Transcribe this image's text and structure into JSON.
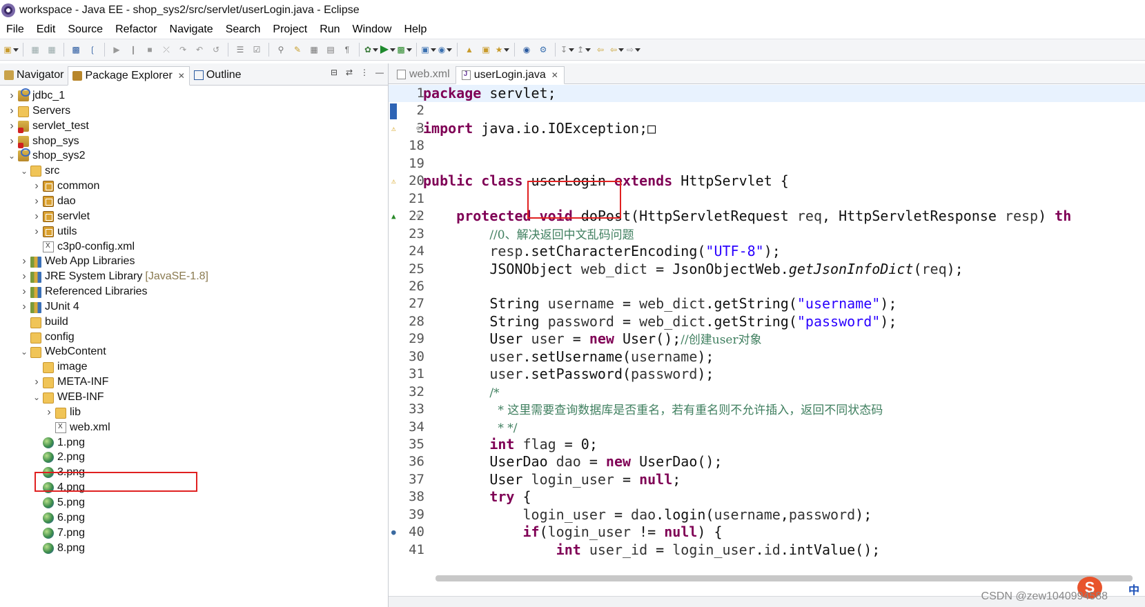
{
  "window": {
    "title": "workspace - Java EE - shop_sys2/src/servlet/userLogin.java - Eclipse"
  },
  "menubar": [
    "File",
    "Edit",
    "Source",
    "Refactor",
    "Navigate",
    "Search",
    "Project",
    "Run",
    "Window",
    "Help"
  ],
  "left_panel": {
    "tabs": [
      {
        "label": "Navigator",
        "icon": "navigator-icon"
      },
      {
        "label": "Package Explorer",
        "icon": "package-explorer-icon",
        "active": true
      },
      {
        "label": "Outline",
        "icon": "outline-icon"
      }
    ],
    "tree": [
      {
        "label": "jdbc_1",
        "icon": "project",
        "indent": 0,
        "chev": "right"
      },
      {
        "label": "Servers",
        "icon": "folder",
        "indent": 0,
        "chev": "right"
      },
      {
        "label": "servlet_test",
        "icon": "project-err",
        "indent": 0,
        "chev": "right"
      },
      {
        "label": "shop_sys",
        "icon": "project-err",
        "indent": 0,
        "chev": "right"
      },
      {
        "label": "shop_sys2",
        "icon": "project",
        "indent": 0,
        "chev": "down"
      },
      {
        "label": "src",
        "icon": "srcfolder",
        "indent": 1,
        "chev": "down"
      },
      {
        "label": "common",
        "icon": "pkg",
        "indent": 2,
        "chev": "right"
      },
      {
        "label": "dao",
        "icon": "pkg",
        "indent": 2,
        "chev": "right"
      },
      {
        "label": "servlet",
        "icon": "pkg",
        "indent": 2,
        "chev": "right"
      },
      {
        "label": "utils",
        "icon": "pkg",
        "indent": 2,
        "chev": "right"
      },
      {
        "label": "c3p0-config.xml",
        "icon": "xml",
        "indent": 2,
        "chev": ""
      },
      {
        "label": "Web App Libraries",
        "icon": "lib",
        "indent": 1,
        "chev": "right"
      },
      {
        "label": "JRE System Library",
        "icon": "lib",
        "indent": 1,
        "chev": "right",
        "decoration": "[JavaSE-1.8]"
      },
      {
        "label": "Referenced Libraries",
        "icon": "lib",
        "indent": 1,
        "chev": "right"
      },
      {
        "label": "JUnit 4",
        "icon": "lib",
        "indent": 1,
        "chev": "right"
      },
      {
        "label": "build",
        "icon": "folder",
        "indent": 1,
        "chev": ""
      },
      {
        "label": "config",
        "icon": "folder",
        "indent": 1,
        "chev": ""
      },
      {
        "label": "WebContent",
        "icon": "folder",
        "indent": 1,
        "chev": "down"
      },
      {
        "label": "image",
        "icon": "folder",
        "indent": 2,
        "chev": ""
      },
      {
        "label": "META-INF",
        "icon": "folder",
        "indent": 2,
        "chev": "right"
      },
      {
        "label": "WEB-INF",
        "icon": "folder",
        "indent": 2,
        "chev": "down"
      },
      {
        "label": "lib",
        "icon": "folder",
        "indent": 3,
        "chev": "right"
      },
      {
        "label": "web.xml",
        "icon": "xml",
        "indent": 3,
        "chev": ""
      },
      {
        "label": "1.png",
        "icon": "png",
        "indent": 2,
        "chev": ""
      },
      {
        "label": "2.png",
        "icon": "png",
        "indent": 2,
        "chev": ""
      },
      {
        "label": "3.png",
        "icon": "png",
        "indent": 2,
        "chev": ""
      },
      {
        "label": "4.png",
        "icon": "png",
        "indent": 2,
        "chev": ""
      },
      {
        "label": "5.png",
        "icon": "png",
        "indent": 2,
        "chev": ""
      },
      {
        "label": "6.png",
        "icon": "png",
        "indent": 2,
        "chev": ""
      },
      {
        "label": "7.png",
        "icon": "png",
        "indent": 2,
        "chev": ""
      },
      {
        "label": "8.png",
        "icon": "png",
        "indent": 2,
        "chev": ""
      }
    ]
  },
  "editor": {
    "tabs": [
      {
        "label": "web.xml",
        "active": false
      },
      {
        "label": "userLogin.java",
        "active": true
      }
    ],
    "lines": [
      {
        "n": "1",
        "html": "<span class=\"kw\">package</span> servlet;",
        "current": true
      },
      {
        "n": "2",
        "html": ""
      },
      {
        "n": "3",
        "html": "<span class=\"kw\">import</span> java.io.IOException;&#9633;",
        "marker": "warn",
        "fold": "+"
      },
      {
        "n": "18",
        "html": ""
      },
      {
        "n": "19",
        "html": ""
      },
      {
        "n": "20",
        "html": "<span class=\"kw\">public</span> <span class=\"kw\">class</span> userLogin <span class=\"kw\">extends</span> HttpServlet {",
        "marker": "warn"
      },
      {
        "n": "21",
        "html": ""
      },
      {
        "n": "22",
        "html": "    <span class=\"kw\">protected</span> <span class=\"kw\">void</span> doPost(HttpServletRequest <span class=\"fld\">req</span>, HttpServletResponse <span class=\"fld\">resp</span>) <span class=\"kw\">th</span>",
        "marker": "arrow",
        "fold": "-"
      },
      {
        "n": "23",
        "html": "        <span class=\"cm\">//0、解决返回中文乱码问题</span>"
      },
      {
        "n": "24",
        "html": "        <span class=\"fld\">resp</span>.setCharacterEncoding(<span class=\"str\">\"UTF-8\"</span>);"
      },
      {
        "n": "25",
        "html": "        JSONObject <span class=\"fld\">web_dict</span> = JsonObjectWeb.<span class=\"it\">getJsonInfoDict</span>(<span class=\"fld\">req</span>);"
      },
      {
        "n": "26",
        "html": ""
      },
      {
        "n": "27",
        "html": "        String <span class=\"fld\">username</span> = <span class=\"fld\">web_dict</span>.getString(<span class=\"str\">\"username\"</span>);"
      },
      {
        "n": "28",
        "html": "        String <span class=\"fld\">password</span> = <span class=\"fld\">web_dict</span>.getString(<span class=\"str\">\"password\"</span>);"
      },
      {
        "n": "29",
        "html": "        User <span class=\"fld\">user</span> = <span class=\"kw\">new</span> User();<span class=\"cm\">//创建user对象</span>"
      },
      {
        "n": "30",
        "html": "        <span class=\"fld\">user</span>.setUsername(<span class=\"fld\">username</span>);"
      },
      {
        "n": "31",
        "html": "        <span class=\"fld\">user</span>.setPassword(<span class=\"fld\">password</span>);"
      },
      {
        "n": "32",
        "html": "        <span class=\"cm\">/*</span>"
      },
      {
        "n": "33",
        "html": "         <span class=\"cm\">* 这里需要查询数据库是否重名，若有重名则不允许插入，返回不同状态码</span>"
      },
      {
        "n": "34",
        "html": "         <span class=\"cm\">* */</span>"
      },
      {
        "n": "35",
        "html": "        <span class=\"kw\">int</span> <span class=\"fld\">flag</span> = 0;"
      },
      {
        "n": "36",
        "html": "        UserDao <span class=\"fld\">dao</span> = <span class=\"kw\">new</span> UserDao();"
      },
      {
        "n": "37",
        "html": "        User <span class=\"fld\">login_user</span> = <span class=\"kw\">null</span>;"
      },
      {
        "n": "38",
        "html": "        <span class=\"kw\">try</span> {"
      },
      {
        "n": "39",
        "html": "            <span class=\"fld\">login_user</span> = <span class=\"fld\">dao</span>.login(<span class=\"fld\">username</span>,<span class=\"fld\">password</span>);"
      },
      {
        "n": "40",
        "html": "            <span class=\"kw\">if</span>(<span class=\"fld\">login_user</span> != <span class=\"kw\">null</span>) {",
        "marker": "dot"
      },
      {
        "n": "41",
        "html": "                <span class=\"kw\">int</span> <span class=\"fld\">user_id</span> = <span class=\"fld\">login_user</span>.<span class=\"fld\">id</span>.intValue();"
      }
    ]
  },
  "watermark": "CSDN @zew1040994588",
  "sogou": {
    "badge": "S",
    "text": "中"
  }
}
